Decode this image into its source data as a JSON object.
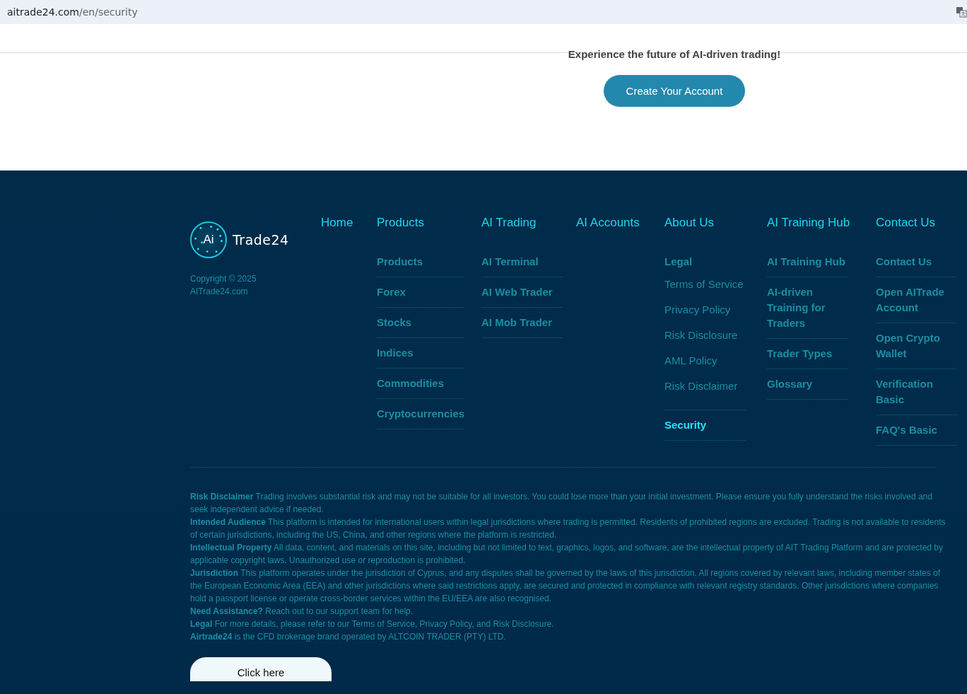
{
  "address_bar": {
    "host": "aitrade24.com",
    "path": "/en/security"
  },
  "cta": {
    "tagline": "Experience the future of AI-driven trading!",
    "button": "Create Your Account"
  },
  "footer": {
    "logo": {
      "mark": "Ai",
      "name": "Trade24"
    },
    "copyright": [
      "Copyright © 2025",
      "AITrade24.com"
    ],
    "columns": [
      {
        "title": "Home"
      },
      {
        "title": "Products",
        "items": [
          {
            "label": "Products",
            "kind": "link",
            "selected": false
          },
          {
            "label": "Forex",
            "kind": "link",
            "selected": false
          },
          {
            "label": "Stocks",
            "kind": "link",
            "selected": false
          },
          {
            "label": "Indices",
            "kind": "link",
            "selected": false
          },
          {
            "label": "Commodities",
            "kind": "link",
            "selected": false
          },
          {
            "label": "Cryptocurrencies",
            "kind": "link",
            "selected": false
          }
        ]
      },
      {
        "title": "AI Trading",
        "items": [
          {
            "label": "AI Terminal",
            "kind": "link",
            "selected": false
          },
          {
            "label": "AI Web Trader",
            "kind": "link",
            "selected": false
          },
          {
            "label": "AI Mob Trader",
            "kind": "link",
            "selected": false
          }
        ]
      },
      {
        "title": "AI Accounts"
      },
      {
        "title": "About Us",
        "items": [
          {
            "label": "Legal",
            "kind": "heading",
            "selected": false
          },
          {
            "label": "Terms of Service",
            "kind": "plain",
            "selected": false
          },
          {
            "label": "Privacy Policy",
            "kind": "plain",
            "selected": false
          },
          {
            "label": "Risk Disclosure",
            "kind": "plain",
            "selected": false
          },
          {
            "label": "AML Policy",
            "kind": "plain",
            "selected": false
          },
          {
            "label": "Risk Disclaimer",
            "kind": "plain",
            "selected": false
          },
          {
            "label": "Security",
            "kind": "link",
            "selected": true
          }
        ]
      },
      {
        "title": "AI Training Hub",
        "items": [
          {
            "label": "AI Training Hub",
            "kind": "link",
            "selected": false
          },
          {
            "label": "AI-driven Training for Traders",
            "kind": "link",
            "selected": false
          },
          {
            "label": "Trader Types",
            "kind": "link",
            "selected": false
          },
          {
            "label": "Glossary",
            "kind": "link",
            "selected": false
          }
        ]
      },
      {
        "title": "Contact Us",
        "items": [
          {
            "label": "Contact Us",
            "kind": "link",
            "selected": false
          },
          {
            "label": "Open AITrade Account",
            "kind": "link",
            "selected": false
          },
          {
            "label": "Open Crypto Wallet",
            "kind": "link",
            "selected": false
          },
          {
            "label": "Verification Basic",
            "kind": "link",
            "selected": false
          },
          {
            "label": "FAQ's Basic",
            "kind": "link",
            "selected": false
          }
        ]
      }
    ],
    "notices": [
      "**Risk Disclaimer** Trading involves substantial risk and may not be suitable for all investors. You could lose more than your initial investment. Please ensure you fully understand the risks involved and seek independent advice if needed.",
      "**Intended Audience** This platform is intended for international users within legal jurisdictions where trading is permitted. Residents of prohibited regions are excluded. Trading is not available to residents of certain jurisdictions, including the US, China, and other regions where the platform is restricted.",
      "**Intellectual Property** All data, content, and materials on this site, including but not limited to text, graphics, logos, and software, are the intellectual property of AIT Trading Platform and are protected by applicable copyright laws. Unauthorized use or reproduction is prohibited.",
      "**Jurisdiction** This platform operates under the jurisdiction of Cyprus, and any disputes shall be governed by the laws of this jurisdiction. All regions covered by relevant laws, including member states of the European Economic Area (EEA) and other jurisdictions where said restrictions apply, are secured and protected in compliance with relevant registry standards. Other jurisdictions where companies hold a passport license or operate cross-border services within the EU/EEA are also recognised.",
      "**Need Assistance?** Reach out to our support team for help.",
      "**Legal** For more details, please refer to our Terms of Service, Privacy Policy, and Risk Disclosure.",
      "**Airtrade24** is the CFD brokerage brand operated by ALTCOIN TRADER (PTY) LTD."
    ],
    "button": "Click here"
  }
}
